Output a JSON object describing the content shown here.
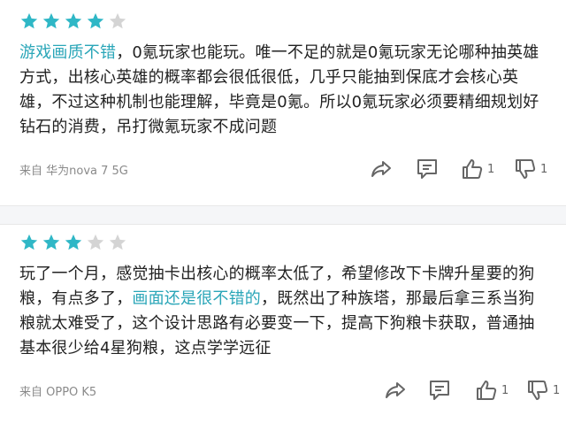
{
  "reviews": [
    {
      "rating": 4,
      "max_rating": 5,
      "text": {
        "highlight": "游戏画质不错",
        "rest": "，0氪玩家也能玩。唯一不足的就是0氪玩家无论哪种抽英雄方式，出核心英雄的概率都会很低很低，几乎只能抽到保底才会核心英雄，不过这种机制也能理解，毕竟是0氪。所以0氪玩家必须要精细规划好钻石的消费，吊打微氪玩家不成问题"
      },
      "device": "来自 华为nova 7 5G",
      "like_count": "1",
      "dislike_count": "1"
    },
    {
      "rating": 3,
      "max_rating": 5,
      "text": {
        "before": "玩了一个月，感觉抽卡出核心的概率太低了，希望修改下卡牌升星要的狗粮，有点多了，",
        "highlight": "画面还是很不错的",
        "after": "，既然出了种族塔，那最后拿三系当狗粮就太难受了，这个设计思路有必要变一下，提高下狗粮卡获取，普通抽基本很少给4星狗粮，这点学学远征"
      },
      "device": "来自 OPPO K5",
      "like_count": "1",
      "dislike_count": "1"
    }
  ],
  "colors": {
    "star_filled": "#2fb7c6",
    "star_empty": "#d4d4d4",
    "highlight": "#2aa6b8",
    "icon": "#666666",
    "separator": "#f5f6f8"
  },
  "icons": [
    "star-icon",
    "share-icon",
    "comment-icon",
    "thumbs-up-icon",
    "thumbs-down-icon"
  ]
}
